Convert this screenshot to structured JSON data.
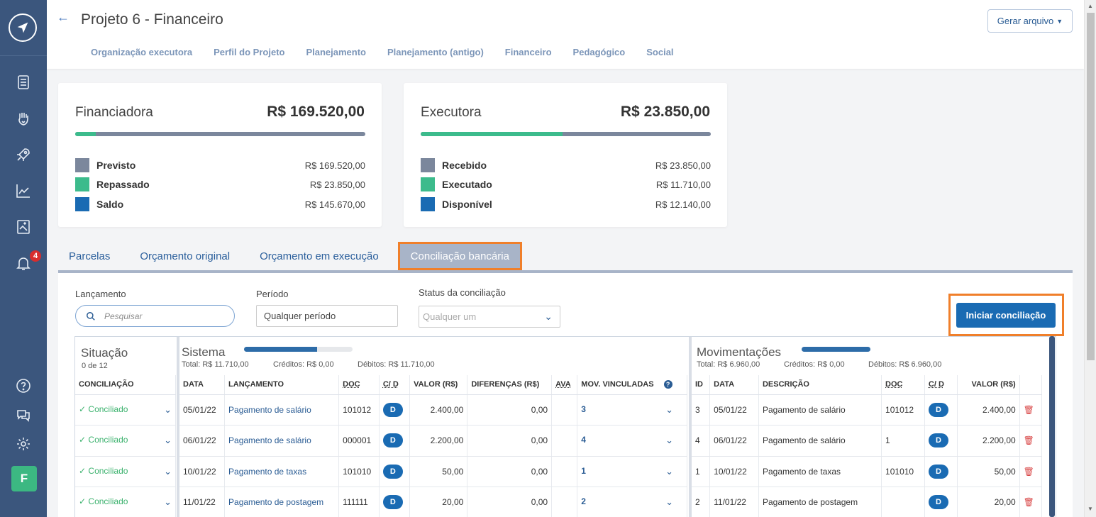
{
  "sidebar": {
    "notification_count": "4",
    "avatar_letter": "F"
  },
  "header": {
    "title": "Projeto 6 - Financeiro",
    "generate_button": "Gerar arquivo",
    "nav": [
      "Organização executora",
      "Perfil do Projeto",
      "Planejamento",
      "Planejamento (antigo)",
      "Financeiro",
      "Pedagógico",
      "Social"
    ]
  },
  "cards": {
    "financiadora": {
      "title": "Financiadora",
      "total": "R$ 169.520,00",
      "progress": 0.07,
      "items": [
        {
          "label": "Previsto",
          "value": "R$ 169.520,00",
          "color": "#7b879c"
        },
        {
          "label": "Repassado",
          "value": "R$ 23.850,00",
          "color": "#3cbb8c"
        },
        {
          "label": "Saldo",
          "value": "R$ 145.670,00",
          "color": "#1a6bb3"
        }
      ]
    },
    "executora": {
      "title": "Executora",
      "total": "R$ 23.850,00",
      "progress": 0.49,
      "items": [
        {
          "label": "Recebido",
          "value": "R$ 23.850,00",
          "color": "#7b879c"
        },
        {
          "label": "Executado",
          "value": "R$ 11.710,00",
          "color": "#3cbb8c"
        },
        {
          "label": "Disponível",
          "value": "R$ 12.140,00",
          "color": "#1a6bb3"
        }
      ]
    }
  },
  "tabs": [
    "Parcelas",
    "Orçamento original",
    "Orçamento em execução",
    "Conciliação bancária"
  ],
  "filters": {
    "lancamento_label": "Lançamento",
    "search_placeholder": "Pesquisar",
    "periodo_label": "Período",
    "periodo_value": "Qualquer período",
    "status_label": "Status da conciliação",
    "status_value": "Qualquer um",
    "start_button": "Iniciar conciliação"
  },
  "situacao": {
    "title": "Situação",
    "count": "0 de 12",
    "header": "CONCILIAÇÃO",
    "rows": [
      "Conciliado",
      "Conciliado",
      "Conciliado",
      "Conciliado"
    ]
  },
  "sistema": {
    "title": "Sistema",
    "progress": 0.67,
    "total": "Total: R$ 11.710,00",
    "creditos": "Créditos: R$ 0,00",
    "debitos": "Débitos: R$ 11.710,00",
    "headers": [
      "DATA",
      "LANÇAMENTO",
      "DOC",
      "C/ D",
      "VALOR (R$)",
      "DIFERENÇAS (R$)",
      "AVA",
      "MOV. VINCULADAS"
    ],
    "rows": [
      {
        "data": "05/01/22",
        "lancamento": "Pagamento de salário",
        "doc": "101012",
        "cd": "D",
        "valor": "2.400,00",
        "dif": "0,00",
        "mov": "3"
      },
      {
        "data": "06/01/22",
        "lancamento": "Pagamento de salário",
        "doc": "000001",
        "cd": "D",
        "valor": "2.200,00",
        "dif": "0,00",
        "mov": "4"
      },
      {
        "data": "10/01/22",
        "lancamento": "Pagamento de taxas",
        "doc": "101010",
        "cd": "D",
        "valor": "50,00",
        "dif": "0,00",
        "mov": "1"
      },
      {
        "data": "11/01/22",
        "lancamento": "Pagamento de postagem",
        "doc": "111111",
        "cd": "D",
        "valor": "20,00",
        "dif": "0,00",
        "mov": "2"
      }
    ]
  },
  "movimentacoes": {
    "title": "Movimentações",
    "progress": 1.0,
    "total": "Total: R$ 6.960,00",
    "creditos": "Créditos: R$ 0,00",
    "debitos": "Débitos: R$ 6.960,00",
    "headers": [
      "ID",
      "DATA",
      "DESCRIÇÃO",
      "DOC",
      "C/ D",
      "VALOR (R$)"
    ],
    "rows": [
      {
        "id": "3",
        "data": "05/01/22",
        "descricao": "Pagamento de salário",
        "doc": "101012",
        "cd": "D",
        "valor": "2.400,00"
      },
      {
        "id": "4",
        "data": "06/01/22",
        "descricao": "Pagamento de salário",
        "doc": "1",
        "cd": "D",
        "valor": "2.200,00"
      },
      {
        "id": "1",
        "data": "10/01/22",
        "descricao": "Pagamento de taxas",
        "doc": "101010",
        "cd": "D",
        "valor": "50,00"
      },
      {
        "id": "2",
        "data": "11/01/22",
        "descricao": "Pagamento de postagem",
        "doc": "",
        "cd": "D",
        "valor": "20,00"
      }
    ]
  }
}
